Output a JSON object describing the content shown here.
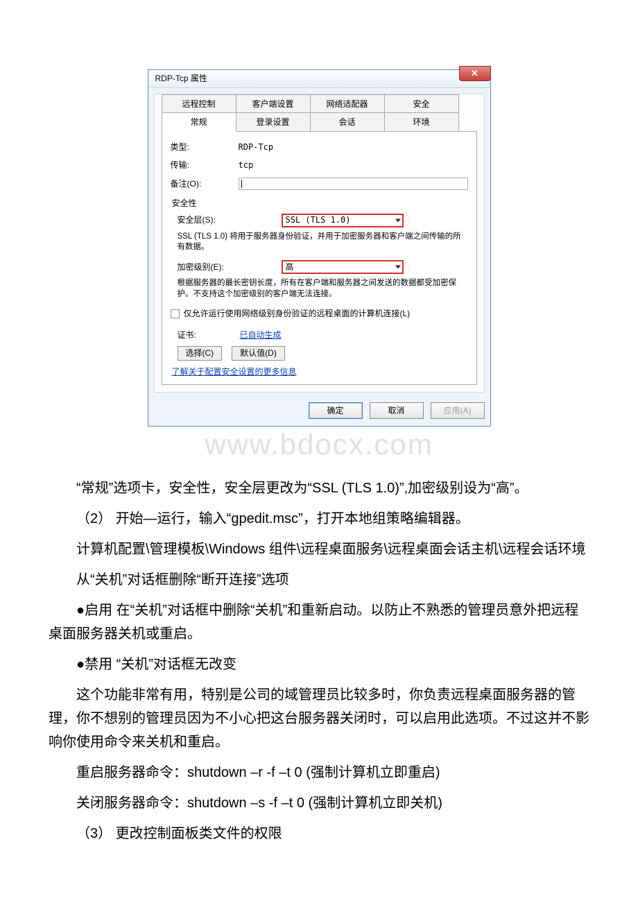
{
  "dialog": {
    "title": "RDP-Tcp 属性",
    "close_glyph": "✕",
    "tabs_row1": [
      "远程控制",
      "客户端设置",
      "网络适配器",
      "安全"
    ],
    "tabs_row2": [
      "常规",
      "登录设置",
      "会话",
      "环境"
    ],
    "active_tab": "常规",
    "fields": {
      "type_label": "类型:",
      "type_value": "RDP-Tcp",
      "transport_label": "传输:",
      "transport_value": "tcp",
      "comment_label": "备注(O):",
      "comment_value": ""
    },
    "security": {
      "heading": "安全性",
      "layer_label": "安全层(S):",
      "layer_value": "SSL (TLS 1.0)",
      "layer_help": "SSL (TLS 1.0) 将用于服务器身份验证，并用于加密服务器和客户端之间传输的所有数据。",
      "enc_label": "加密级别(E):",
      "enc_value": "高",
      "enc_help": "根据服务器的最长密钥长度，所有在客户端和服务器之间发送的数据都受加密保护。不支持这个加密级别的客户端无法连接。",
      "nla_checkbox": "仅允许运行使用网络级别身份验证的远程桌面的计算机连接(L)",
      "cert_label": "证书:",
      "cert_value": "已自动生成",
      "select_btn": "选择(C)",
      "default_btn": "默认值(D)",
      "more_link": "了解关于配置安全设置的更多信息"
    },
    "footer": {
      "ok": "确定",
      "cancel": "取消",
      "apply": "应用(A)"
    }
  },
  "watermark": "www.bdocx.com",
  "doc": {
    "p1": "“常规”选项卡，安全性，安全层更改为“SSL (TLS 1.0)”,加密级别设为“高”。",
    "p2": "（2） 开始—运行，输入“gpedit.msc”，打开本地组策略编辑器。",
    "p3": "计算机配置\\管理模板\\Windows 组件\\远程桌面服务\\远程桌面会话主机\\远程会话环境",
    "p4": "从“关机”对话框删除“断开连接”选项",
    "p5": "●启用 在“关机”对话框中删除“关机”和重新启动。以防止不熟悉的管理员意外把远程桌面服务器关机或重启。",
    "p6": "●禁用 “关机”对话框无改变",
    "p7": "这个功能非常有用，特别是公司的域管理员比较多时，你负责远程桌面服务器的管理，你不想别的管理员因为不小心把这台服务器关闭时，可以启用此选项。不过这并不影响你使用命令来关机和重启。",
    "p8": "重启服务器命令：shutdown –r -f –t 0 (强制计算机立即重启)",
    "p9": "关闭服务器命令：shutdown –s -f –t 0 (强制计算机立即关机)",
    "p10": "（3） 更改控制面板类文件的权限"
  }
}
